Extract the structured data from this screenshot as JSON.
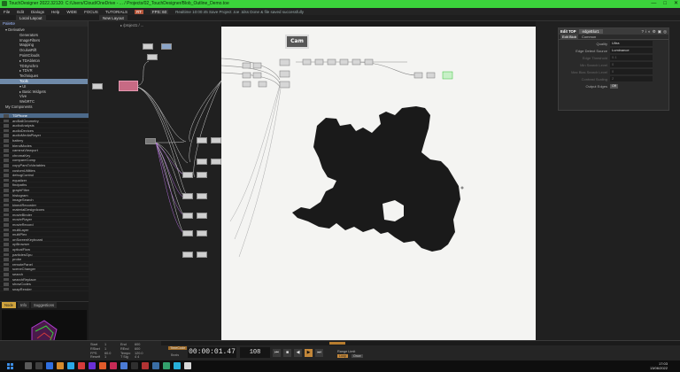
{
  "window": {
    "title": "TouchDesigner 2022.32120: C:/Users/Cloud/OneDrive - ... / Projects/02_TouchDesigner/Blob_Outline_Demo.toe",
    "controls": [
      "—",
      "□",
      "✕"
    ]
  },
  "menubar": {
    "items": [
      "File",
      "Edit",
      "Dialogs",
      "Help",
      "WIDE",
      "FOCUS",
      "TUTORIALS"
    ],
    "chip": "RT",
    "fps_label": "FPS: 60",
    "status": "Realtime   10:00:45 Save Project  .toe .tdss  Done & file saved successfully"
  },
  "tabs": {
    "first": "Local Layout",
    "second": "New Layout"
  },
  "palette": {
    "header": "Palette",
    "tree": [
      {
        "label": "▾ Derivative",
        "indent": false,
        "selected": false
      },
      {
        "label": "Generators",
        "indent": true,
        "selected": false
      },
      {
        "label": "ImageFilters",
        "indent": true,
        "selected": false
      },
      {
        "label": "Mapping",
        "indent": true,
        "selected": false
      },
      {
        "label": "OculusRift",
        "indent": true,
        "selected": false
      },
      {
        "label": "PointClouds",
        "indent": true,
        "selected": false
      },
      {
        "label": "▸ TDAbleton",
        "indent": true,
        "selected": false
      },
      {
        "label": "TDSynchro",
        "indent": true,
        "selected": false
      },
      {
        "label": "▸ TDVR",
        "indent": true,
        "selected": false
      },
      {
        "label": "Techniques",
        "indent": true,
        "selected": false
      },
      {
        "label": "Tools",
        "indent": true,
        "selected": true
      },
      {
        "label": "▾ UI",
        "indent": true,
        "selected": false
      },
      {
        "label": "▸ Basic Widgets",
        "indent": true,
        "selected": false
      },
      {
        "label": "Vive",
        "indent": true,
        "selected": false
      },
      {
        "label": "WebRTC",
        "indent": true,
        "selected": false
      },
      {
        "label": "My Components",
        "indent": false,
        "selected": false
      }
    ],
    "list": [
      {
        "label": "TDPhone",
        "selected": true
      },
      {
        "label": "arcBallGeometry",
        "selected": false
      },
      {
        "label": "audioAnalysis",
        "selected": false
      },
      {
        "label": "audioDevices",
        "selected": false
      },
      {
        "label": "audioMediaPlayer",
        "selected": false
      },
      {
        "label": "battery",
        "selected": false
      },
      {
        "label": "blendModes",
        "selected": false
      },
      {
        "label": "cameraViewport",
        "selected": false
      },
      {
        "label": "chromaKey",
        "selected": false
      },
      {
        "label": "compareComp",
        "selected": false
      },
      {
        "label": "copyParsToVariables",
        "selected": false
      },
      {
        "label": "customUtilities",
        "selected": false
      },
      {
        "label": "debugControl",
        "selected": false
      },
      {
        "label": "equalizer",
        "selected": false
      },
      {
        "label": "findpaths",
        "selected": false
      },
      {
        "label": "graphFilter",
        "selected": false
      },
      {
        "label": "histogram",
        "selected": false
      },
      {
        "label": "imageSearch",
        "selected": false
      },
      {
        "label": "kinectRecorder",
        "selected": false
      },
      {
        "label": "materialDesignIcons",
        "selected": false
      },
      {
        "label": "movieBinder",
        "selected": false
      },
      {
        "label": "moviePlayer",
        "selected": false
      },
      {
        "label": "movieRecord",
        "selected": false
      },
      {
        "label": "multiLayer",
        "selected": false
      },
      {
        "label": "multiPlex",
        "selected": false
      },
      {
        "label": "onScreenKeyboard",
        "selected": false
      },
      {
        "label": "opBrowser",
        "selected": false
      },
      {
        "label": "opticalFlow",
        "selected": false
      },
      {
        "label": "particlesGpu",
        "selected": false
      },
      {
        "label": "probe",
        "selected": false
      },
      {
        "label": "remotePanel",
        "selected": false
      },
      {
        "label": "sceneChanger",
        "selected": false
      },
      {
        "label": "search",
        "selected": false
      },
      {
        "label": "searchReplace",
        "selected": false
      },
      {
        "label": "showCodes",
        "selected": false
      },
      {
        "label": "snapRender",
        "selected": false
      }
    ]
  },
  "preview": {
    "tabs": [
      "Node",
      "Info",
      "Suggestions"
    ]
  },
  "network": {
    "path": "▸ /project1 / ..."
  },
  "viewer": {
    "cam_label": "Cam"
  },
  "params": {
    "op_type": "Edit TOP",
    "op_name": "edgeBlur1",
    "icons": [
      "?",
      "i",
      "◐",
      "⚙",
      "▣",
      "◎"
    ],
    "tabs": [
      "Edit Blob",
      "Common"
    ],
    "rows": [
      {
        "label": "Quality",
        "value": "Ultra",
        "dim": false
      },
      {
        "label": "Edge Detect Source",
        "value": "Luminance",
        "dim": false
      },
      {
        "label": "Edge Threshold",
        "value": "0.1",
        "dim": true
      },
      {
        "label": "Min Search Level",
        "value": "0",
        "dim": true
      },
      {
        "label": "Max Bias Search Level",
        "value": "0",
        "dim": true
      },
      {
        "label": "Contrast Scaling",
        "value": "2",
        "dim": true
      }
    ],
    "toggle_label": "Output Edges",
    "toggle_value": "Off"
  },
  "bottombar": {
    "stats": [
      "Start",
      "1",
      "End",
      "600",
      "RStart",
      "1",
      "REnd",
      "600",
      "FPS",
      "60.0",
      "Tempo",
      "120.0",
      "Resetf",
      "1",
      "T Sig",
      "4   4"
    ],
    "timecode_label": "TimeCode",
    "beats_label": "Beats",
    "timecode": "00:00:01.47",
    "frame": "108",
    "transport": [
      "⏮",
      "■",
      "◀",
      "▶",
      "⏭"
    ],
    "range_label": "Range Limit",
    "range_off": "Loop",
    "range_on": "Once"
  },
  "taskbar": {
    "time": "17:03",
    "date": "13/06/2022",
    "app_colors": [
      "#5a5a5a",
      "#3f3f3f",
      "#2f6fe0",
      "#d58a2b",
      "#2aa7e6",
      "#d63b3b",
      "#6a2fd6",
      "#e05a2a",
      "#c72a55",
      "#4b7bd6",
      "#2f2f2f",
      "#b23333",
      "#3a6ea5",
      "#33a06c",
      "#27b0d9",
      "#d8d8d8"
    ]
  }
}
